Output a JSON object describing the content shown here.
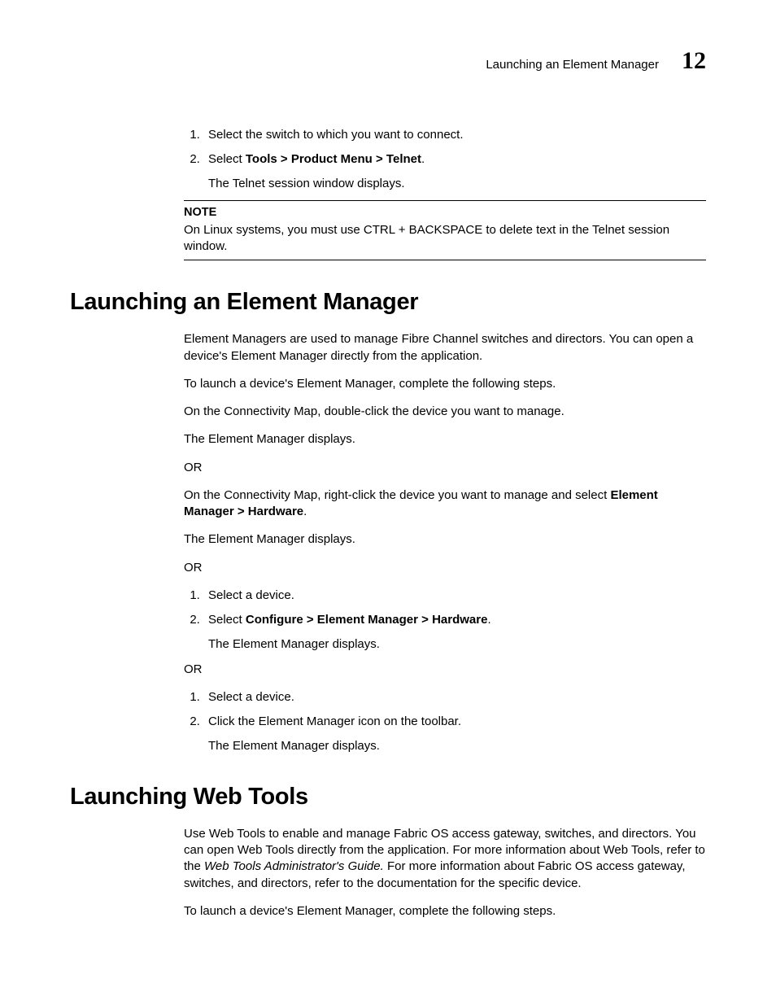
{
  "header": {
    "title": "Launching an Element Manager",
    "chapter_number": "12"
  },
  "intro_steps": {
    "step1": "Select the switch to which you want to connect.",
    "step2_pre": "Select ",
    "step2_bold": "Tools > Product Menu > Telnet",
    "step2_post": ".",
    "step2_sub": "The Telnet session window displays."
  },
  "note": {
    "label": "NOTE",
    "text": "On Linux systems, you must use CTRL + BACKSPACE to delete text in the Telnet session window."
  },
  "section1": {
    "heading": "Launching an Element Manager",
    "p1": "Element Managers are used to manage Fibre Channel switches and directors. You can open a device's Element Manager directly from the application.",
    "p2": "To launch a device's Element Manager, complete the following steps.",
    "p3": "On the Connectivity Map, double-click the device you want to manage.",
    "p4": "The Element Manager displays.",
    "or": "OR",
    "p5_pre": "On the Connectivity Map, right-click the device you want to manage and select ",
    "p5_bold": "Element Manager > Hardware",
    "p5_post": ".",
    "p6": "The Element Manager displays.",
    "listA": {
      "i1": "Select a device.",
      "i2_pre": "Select ",
      "i2_bold": "Configure > Element Manager > Hardware",
      "i2_post": ".",
      "i2_sub": "The Element Manager displays."
    },
    "listB": {
      "i1": "Select a device.",
      "i2": "Click the Element Manager icon on the toolbar.",
      "i2_sub": "The Element Manager displays."
    }
  },
  "section2": {
    "heading": "Launching Web Tools",
    "p1_a": "Use Web Tools to enable and manage Fabric OS access gateway, switches, and directors. You can open Web Tools directly from the application. For more information about Web Tools, refer to the ",
    "p1_italic": "Web Tools Administrator's Guide.",
    "p1_b": " For more information about Fabric OS access gateway, switches, and directors, refer to the documentation for the specific device.",
    "p2": "To launch a device's Element Manager, complete the following steps."
  }
}
